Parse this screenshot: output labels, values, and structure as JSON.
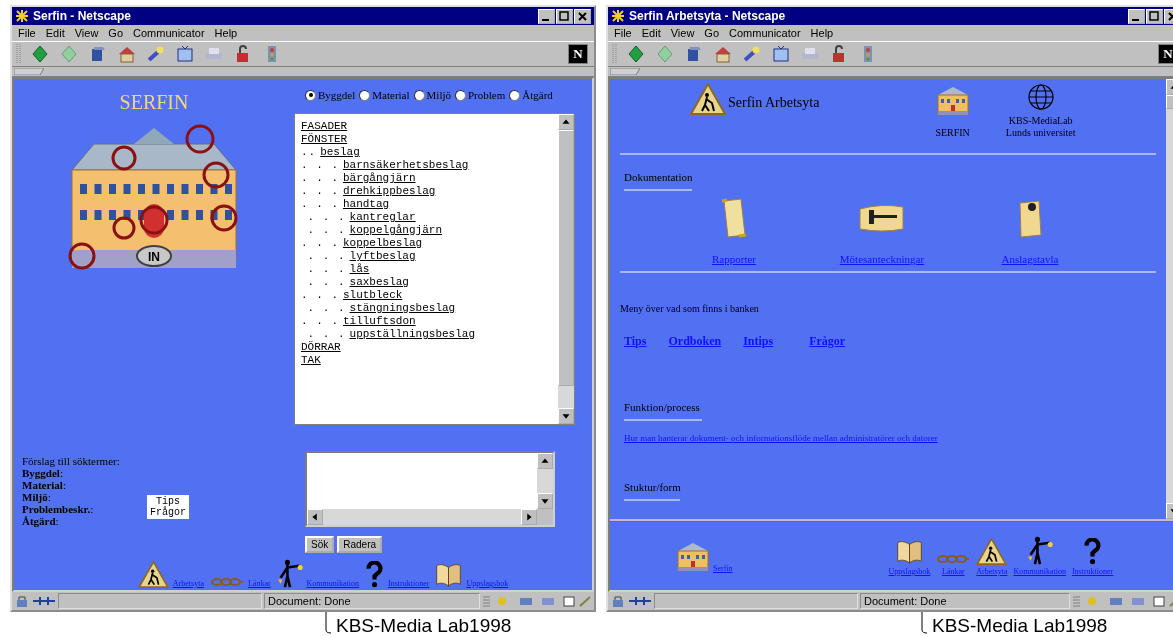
{
  "windows": [
    {
      "kind": "search",
      "title": "Serfin - Netscape",
      "menu": [
        "File",
        "Edit",
        "View",
        "Go",
        "Communicator",
        "Help"
      ],
      "logo_letter": "N",
      "status": "Document: Done",
      "caption": "KBS-Media Lab1998",
      "page": {
        "heading": "SERFIN",
        "entrance_label": "IN",
        "radios": [
          {
            "label": "Byggdel",
            "selected": true
          },
          {
            "label": "Material",
            "selected": false
          },
          {
            "label": "Miljö",
            "selected": false
          },
          {
            "label": "Problem",
            "selected": false
          },
          {
            "label": "Åtgärd",
            "selected": false
          }
        ],
        "tree": [
          {
            "label": "FASADER"
          },
          {
            "label": "FÖNSTER",
            "children": [
              {
                "dots": "..",
                "label": "beslag",
                "children": [
                  {
                    "dots": ". . .",
                    "label": "barnsäkerhetsbeslag"
                  },
                  {
                    "dots": ". . .",
                    "label": "bärgångjärn"
                  },
                  {
                    "dots": ". . .",
                    "label": "drehkippbeslag"
                  },
                  {
                    "dots": ". . .",
                    "label": "handtag",
                    "children": [
                      {
                        "dots": ". . .",
                        "label": "kantreglar"
                      },
                      {
                        "dots": ". . .",
                        "label": "koppelgångjärn"
                      }
                    ]
                  },
                  {
                    "dots": ". . .",
                    "label": "koppelbeslag",
                    "children": [
                      {
                        "dots": ". . .",
                        "label": "lyftbeslag"
                      },
                      {
                        "dots": ". . .",
                        "label": "lås"
                      },
                      {
                        "dots": ". . .",
                        "label": "saxbeslag"
                      }
                    ]
                  },
                  {
                    "dots": ". . .",
                    "label": "slutbleck",
                    "children": [
                      {
                        "dots": ". . .",
                        "label": "stängningsbeslag"
                      }
                    ]
                  },
                  {
                    "dots": ". . .",
                    "label": "tilluftsdon",
                    "children": [
                      {
                        "dots": ". . .",
                        "label": "uppställningsbeslag"
                      }
                    ]
                  }
                ]
              }
            ]
          },
          {
            "label": "DÖRRAR"
          },
          {
            "label": "TAK"
          }
        ],
        "terms_title": "Förslag till söktermer:",
        "terms": [
          "**Byggdel**:",
          "**Material**:",
          "**Miljö**:",
          "**Problembeskr.**:",
          "**Åtgärd**:"
        ],
        "tips_button": [
          "Tips",
          "Frågor"
        ],
        "buttons": [
          "Sök",
          "Radera"
        ],
        "nav": [
          {
            "kind": "worker",
            "label": "Arbetsyta"
          },
          {
            "kind": "chain",
            "label": "Länkar"
          },
          {
            "kind": "person",
            "label": "Kommunikation"
          },
          {
            "kind": "question",
            "label": "Instruktioner"
          },
          {
            "kind": "book",
            "label": "Uppslagsbok"
          }
        ]
      }
    },
    {
      "kind": "workspace",
      "title": "Serfin Arbetsyta - Netscape",
      "menu": [
        "File",
        "Edit",
        "View",
        "Go",
        "Communicator",
        "Help"
      ],
      "logo_letter": "N",
      "status": "Document: Done",
      "caption": "KBS-Media Lab1998",
      "page": {
        "title": "Serfin Arbetsyta",
        "logos": [
          {
            "kind": "building",
            "lines": [
              "SERFIN"
            ]
          },
          {
            "kind": "globe",
            "lines": [
              "KBS-MediaLab",
              "Lunds universitet"
            ]
          }
        ],
        "doc_heading": "Dokumentation",
        "docs": [
          {
            "kind": "scroll",
            "label": "Rapporter"
          },
          {
            "kind": "gavel",
            "label": "Mötesanteckningar"
          },
          {
            "kind": "note",
            "label": "Anslagstavla"
          }
        ],
        "menu_text": "Meny över vad som finns i banken",
        "bank_links": [
          "Tips",
          "Ordboken",
          "Intips",
          "Frågor"
        ],
        "process_heading": "Funktion/process",
        "process_link": "Hur man hanterar dokument- och informationsflöde mellan administratörer och datorer",
        "structure_heading": "Stuktur/form",
        "footer_home": {
          "kind": "building",
          "label": "Serfin"
        },
        "footer_nav": [
          {
            "kind": "book",
            "label": "Uppslagsbok"
          },
          {
            "kind": "chain",
            "label": "Länkar"
          },
          {
            "kind": "worker",
            "label": "Arbetsyta"
          },
          {
            "kind": "person",
            "label": "Kommunikation"
          },
          {
            "kind": "question",
            "label": "Instruktioner"
          }
        ]
      }
    }
  ]
}
